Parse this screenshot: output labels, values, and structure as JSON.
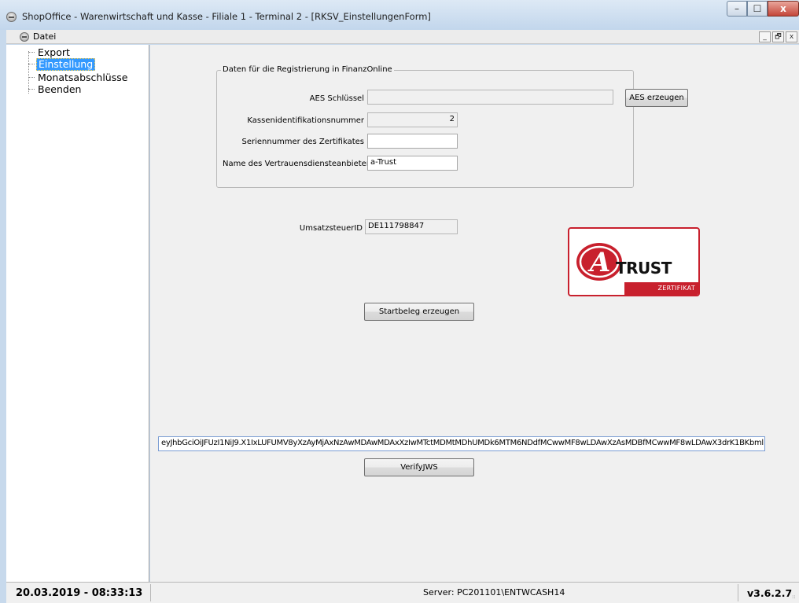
{
  "window": {
    "title": "ShopOffice - Warenwirtschaft und Kasse - Filiale 1 - Terminal 2 - [RKSV_EinstellungenForm]",
    "min_symbol": "–",
    "max_symbol": "☐",
    "close_symbol": "x"
  },
  "menubar": {
    "datei_label": "Datei",
    "mdi_min": "_",
    "mdi_restore": "🗗",
    "mdi_close": "x"
  },
  "tree": {
    "items": [
      {
        "label": "Export",
        "selected": false
      },
      {
        "label": "Einstellung",
        "selected": true
      },
      {
        "label": "Monatsabschlüsse",
        "selected": false
      },
      {
        "label": "Beenden",
        "selected": false
      }
    ]
  },
  "registration": {
    "group_title": "Daten für die Registrierung in FinanzOnline",
    "aes_label": "AES Schlüssel",
    "aes_value": "",
    "aes_button": "AES erzeugen",
    "kassen_label": "Kassenidentifikationsnummer",
    "kassen_value": "2",
    "serial_label": "Seriennummer des Zertifikates",
    "serial_value": "",
    "provider_label": "Name des Vertrauensdiensteanbieter",
    "provider_value": "a-Trust"
  },
  "tax": {
    "label": "UmsatzsteuerID",
    "value": "DE111798847"
  },
  "logo": {
    "word": "TRUST",
    "band": "ZERTIFIKAT",
    "letter": "A"
  },
  "actions": {
    "startbeleg_button": "Startbeleg erzeugen",
    "verify_button": "VerifyJWS"
  },
  "jws": {
    "value": "eyJhbGciOiJFUzI1NiJ9.X1IxLUFUMV8yXzAyMjAxNzAwMDAwMDAxXzIwMTctMDMtMDhUMDk6MTM6NDdfMCwwMF8wLDAwXzAsMDBfMCwwMF8wLDAwX3drK1BKbml"
  },
  "status": {
    "datetime": "20.03.2019 - 08:33:13",
    "server": "Server: PC201101\\ENTWCASH14",
    "version": "v3.6.2.7"
  },
  "colors": {
    "brand_red": "#c8202d",
    "selection_blue": "#3399ff"
  }
}
